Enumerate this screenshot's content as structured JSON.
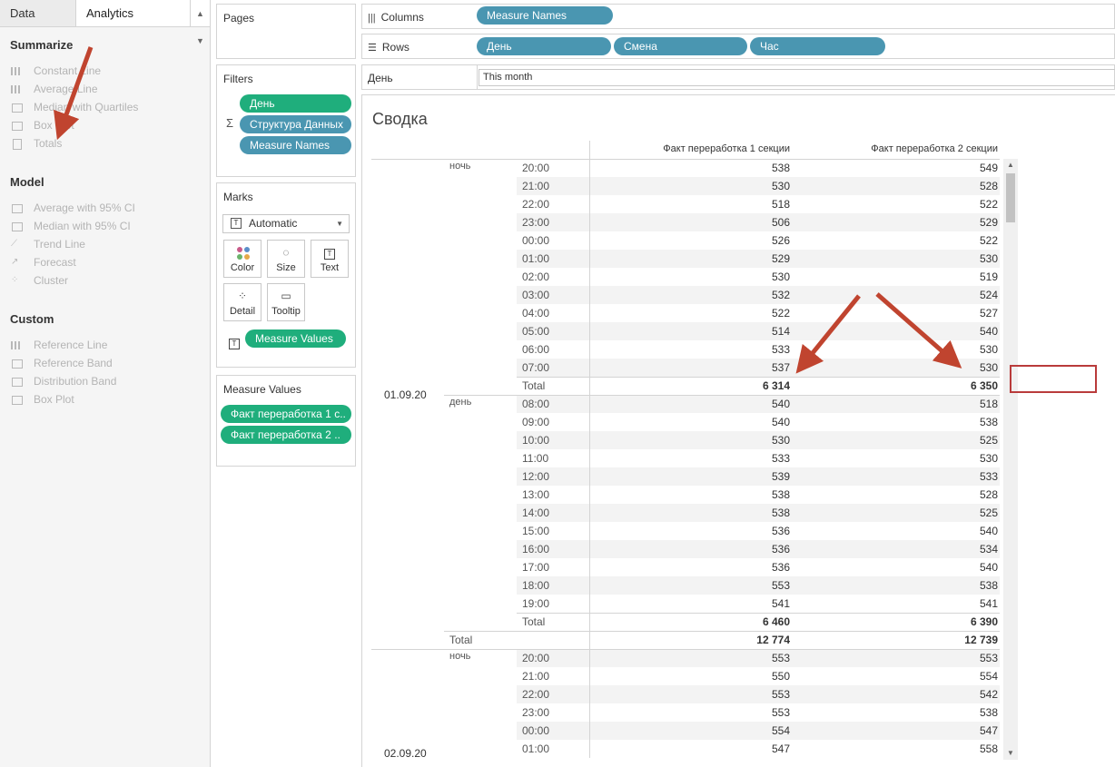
{
  "left_pane": {
    "tab_data": "Data",
    "tab_analytics": "Analytics",
    "sections": [
      {
        "title": "Summarize",
        "items": [
          "Constant Line",
          "Average Line",
          "Median with Quartiles",
          "Box Plot",
          "Totals"
        ]
      },
      {
        "title": "Model",
        "items": [
          "Average with 95% CI",
          "Median with 95% CI",
          "Trend Line",
          "Forecast",
          "Cluster"
        ]
      },
      {
        "title": "Custom",
        "items": [
          "Reference Line",
          "Reference Band",
          "Distribution Band",
          "Box Plot"
        ]
      }
    ]
  },
  "pages": {
    "title": "Pages"
  },
  "filters": {
    "title": "Filters",
    "pills": [
      "День",
      "Структура Данных",
      "Measure Names"
    ]
  },
  "marks": {
    "title": "Marks",
    "type": "Automatic",
    "buttons": [
      "Color",
      "Size",
      "Text",
      "Detail",
      "Tooltip"
    ],
    "text_pill": "Measure Values"
  },
  "measure_values": {
    "title": "Measure Values",
    "pills": [
      "Факт переработка 1 с..",
      "Факт переработка 2 .."
    ]
  },
  "shelves": {
    "columns_label": "Columns",
    "columns_pills": [
      "Measure Names"
    ],
    "rows_label": "Rows",
    "rows_pills": [
      "День",
      "Смена",
      "Час"
    ],
    "filter_label": "День",
    "filter_value": "This month"
  },
  "view": {
    "title": "Сводка",
    "col_headers": [
      "Факт переработка 1 секции",
      "Факт переработка 2 секции"
    ],
    "days": [
      "01.09.20",
      "02.09.20"
    ],
    "shifts": [
      "ночь",
      "день",
      "ночь"
    ],
    "total_label": "Total",
    "rows": [
      {
        "hour": "20:00",
        "v1": "538",
        "v2": "549"
      },
      {
        "hour": "21:00",
        "v1": "530",
        "v2": "528"
      },
      {
        "hour": "22:00",
        "v1": "518",
        "v2": "522"
      },
      {
        "hour": "23:00",
        "v1": "506",
        "v2": "529"
      },
      {
        "hour": "00:00",
        "v1": "526",
        "v2": "522"
      },
      {
        "hour": "01:00",
        "v1": "529",
        "v2": "530"
      },
      {
        "hour": "02:00",
        "v1": "530",
        "v2": "519"
      },
      {
        "hour": "03:00",
        "v1": "532",
        "v2": "524"
      },
      {
        "hour": "04:00",
        "v1": "522",
        "v2": "527"
      },
      {
        "hour": "05:00",
        "v1": "514",
        "v2": "540"
      },
      {
        "hour": "06:00",
        "v1": "533",
        "v2": "530"
      },
      {
        "hour": "07:00",
        "v1": "537",
        "v2": "530"
      },
      {
        "hour": "Total",
        "v1": "6 314",
        "v2": "6 350"
      },
      {
        "hour": "08:00",
        "v1": "540",
        "v2": "518"
      },
      {
        "hour": "09:00",
        "v1": "540",
        "v2": "538"
      },
      {
        "hour": "10:00",
        "v1": "530",
        "v2": "525"
      },
      {
        "hour": "11:00",
        "v1": "533",
        "v2": "530"
      },
      {
        "hour": "12:00",
        "v1": "539",
        "v2": "533"
      },
      {
        "hour": "13:00",
        "v1": "538",
        "v2": "528"
      },
      {
        "hour": "14:00",
        "v1": "538",
        "v2": "525"
      },
      {
        "hour": "15:00",
        "v1": "536",
        "v2": "540"
      },
      {
        "hour": "16:00",
        "v1": "536",
        "v2": "534"
      },
      {
        "hour": "17:00",
        "v1": "536",
        "v2": "540"
      },
      {
        "hour": "18:00",
        "v1": "553",
        "v2": "538"
      },
      {
        "hour": "19:00",
        "v1": "541",
        "v2": "541"
      },
      {
        "hour": "Total",
        "v1": "6 460",
        "v2": "6 390"
      },
      {
        "hour": "",
        "v1": "12 774",
        "v2": "12 739"
      },
      {
        "hour": "20:00",
        "v1": "553",
        "v2": "553"
      },
      {
        "hour": "21:00",
        "v1": "550",
        "v2": "554"
      },
      {
        "hour": "22:00",
        "v1": "553",
        "v2": "542"
      },
      {
        "hour": "23:00",
        "v1": "553",
        "v2": "538"
      },
      {
        "hour": "00:00",
        "v1": "554",
        "v2": "547"
      },
      {
        "hour": "01:00",
        "v1": "547",
        "v2": "558"
      }
    ]
  },
  "colors": {
    "pill_green": "#1fae7c",
    "pill_blue": "#4a96b1",
    "annotation_red": "#c0442f",
    "band": "#f3f3f3"
  }
}
